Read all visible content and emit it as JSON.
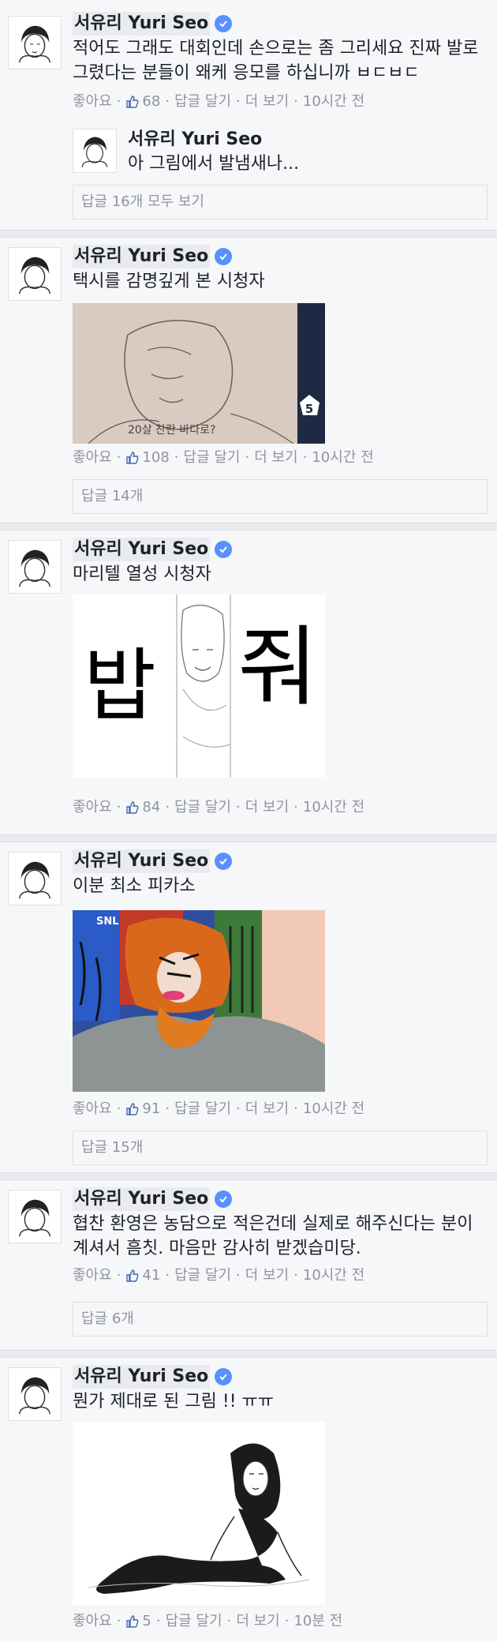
{
  "author": "서유리 Yuri Seo",
  "labels": {
    "like": "좋아요",
    "reply": "답글 달기",
    "more": "더 보기"
  },
  "comments": [
    {
      "text": "적어도 그래도 대회인데 손으로는 좀 그리세요 진짜 발로 그렸다는 분들이 왜케 응모를 하십니까 ㅂㄷㅂㄷ",
      "likes": "68",
      "time": "10시간 전",
      "nested_reply": {
        "name": "서유리 Yuri Seo",
        "text": "아 그림에서 발냄새나..."
      },
      "replies": "답글 16개 모두 보기"
    },
    {
      "text": "택시를 감명깊게 본 시청자",
      "likes": "108",
      "time": "10시간 전",
      "image_badge": "5",
      "image_caption": "20살 찬란 바다로?",
      "replies": "답글 14개"
    },
    {
      "text": "마리텔 열성 시청자",
      "likes": "84",
      "time": "10시간 전",
      "image_left_text": "밥",
      "image_right_text": "줘"
    },
    {
      "text": "이분 최소 피카소",
      "likes": "91",
      "time": "10시간 전",
      "image_logo": "SNL",
      "replies": "답글 15개"
    },
    {
      "text": "협찬 환영은 농담으로 적은건데 실제로 해주신다는 분이 계셔서 흠칫. 마음만 감사히 받겠습미당.",
      "likes": "41",
      "time": "10시간 전",
      "replies": "답글 6개"
    },
    {
      "text": "뭔가 제대로 된 그림 !! ㅠㅠ",
      "likes": "5",
      "time": "10분 전"
    }
  ],
  "colors": {
    "background": "#f6f7f9",
    "divider": "#e9ebee",
    "meta_gray": "#90949c",
    "link_blue": "#4267b2",
    "verified_blue": "#5890ff"
  },
  "icons": [
    "avatar-sketch-icon",
    "verified-badge-icon",
    "thumbs-up-icon"
  ]
}
